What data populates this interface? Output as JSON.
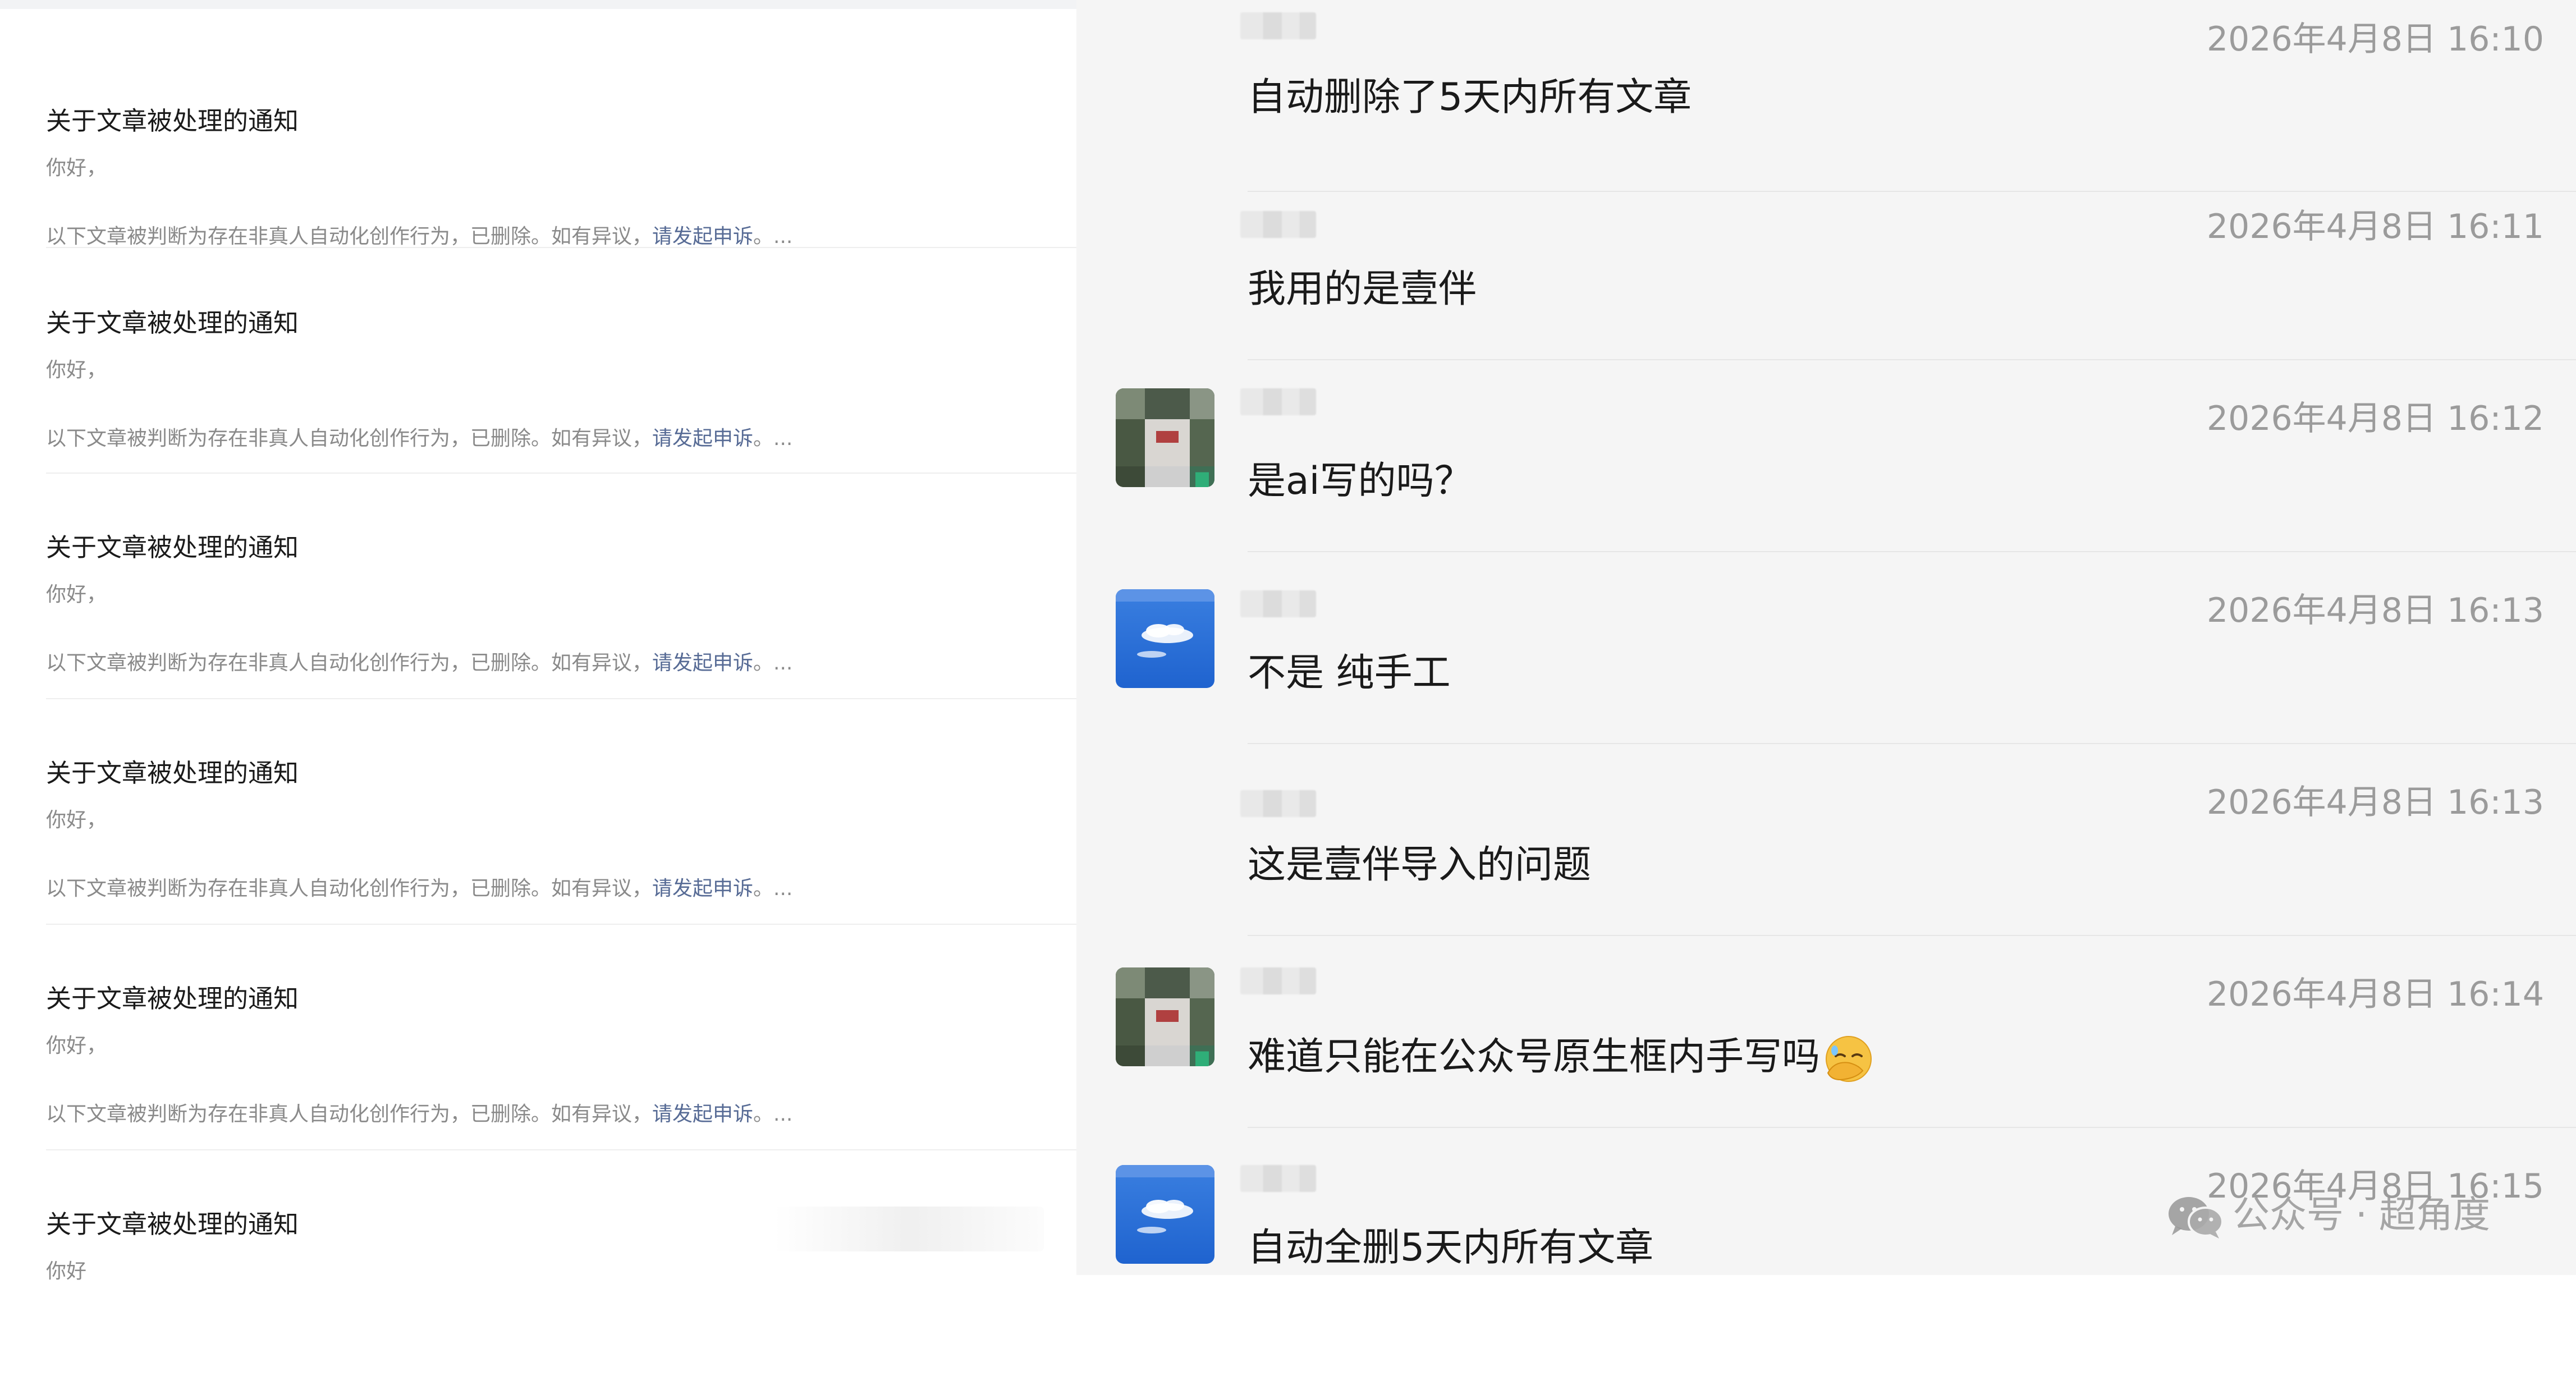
{
  "notices": {
    "items": [
      {
        "title": "关于文章被处理的通知",
        "greeting": "你好，",
        "body_text": "以下文章被判断为存在非真人自动化创作行为，已删除。如有异议，",
        "appeal_link": "请发起申诉",
        "ellipsis": "。..."
      },
      {
        "title": "关于文章被处理的通知",
        "greeting": "你好，",
        "body_text": "以下文章被判断为存在非真人自动化创作行为，已删除。如有异议，",
        "appeal_link": "请发起申诉",
        "ellipsis": "。..."
      },
      {
        "title": "关于文章被处理的通知",
        "greeting": "你好，",
        "body_text": "以下文章被判断为存在非真人自动化创作行为，已删除。如有异议，",
        "appeal_link": "请发起申诉",
        "ellipsis": "。..."
      },
      {
        "title": "关于文章被处理的通知",
        "greeting": "你好，",
        "body_text": "以下文章被判断为存在非真人自动化创作行为，已删除。如有异议，",
        "appeal_link": "请发起申诉",
        "ellipsis": "。..."
      },
      {
        "title": "关于文章被处理的通知",
        "greeting": "你好，",
        "body_text": "以下文章被判断为存在非真人自动化创作行为，已删除。如有异议，",
        "appeal_link": "请发起申诉",
        "ellipsis": "。..."
      },
      {
        "title": "关于文章被处理的通知",
        "greeting": "你好",
        "body_text": "",
        "appeal_link": "",
        "ellipsis": ""
      }
    ]
  },
  "chat": {
    "messages": [
      {
        "avatar": "none",
        "time": "2026年4月8日 16:10",
        "text": "自动删除了5天内所有文章"
      },
      {
        "avatar": "none",
        "time": "2026年4月8日 16:11",
        "text": "我用的是壹伴"
      },
      {
        "avatar": "person-photo",
        "time": "2026年4月8日 16:12",
        "text": "是ai写的吗？"
      },
      {
        "avatar": "blue-cloud",
        "time": "2026年4月8日 16:13",
        "text": "不是 纯手工"
      },
      {
        "avatar": "none",
        "time": "2026年4月8日 16:13",
        "text": "这是壹伴导入的问题"
      },
      {
        "avatar": "person-photo",
        "time": "2026年4月8日 16:14",
        "text": "难道只能在公众号原生框内手写吗",
        "emoji": "facepalm-emoji"
      },
      {
        "avatar": "blue-cloud",
        "time": "2026年4月8日 16:15",
        "text": "自动全删5天内所有文章"
      }
    ]
  },
  "watermark": {
    "text": "公众号 · 超角度",
    "icon": "wechat-icon"
  },
  "colors": {
    "link": "#576b95",
    "chat_background": "#f5f5f5",
    "timestamp": "#9b9b9b",
    "avatar_blue": "#1f63cf"
  }
}
